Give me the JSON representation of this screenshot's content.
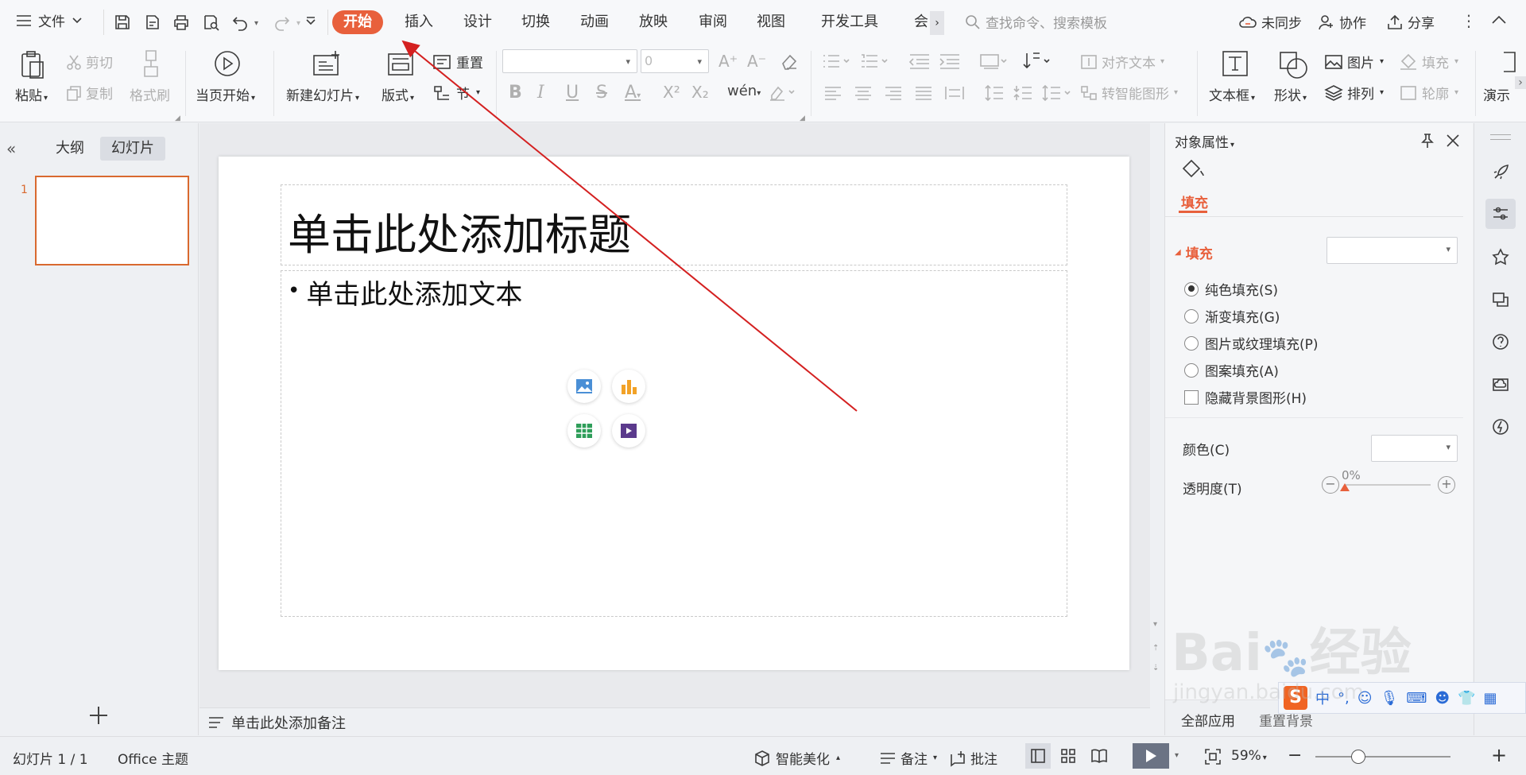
{
  "menu": {
    "file_label": "文件",
    "tabs": [
      "开始",
      "插入",
      "设计",
      "切换",
      "动画",
      "放映",
      "审阅",
      "视图",
      "开发工具",
      "会"
    ],
    "search_placeholder": "查找命令、搜索模板",
    "sync": "未同步",
    "collab": "协作",
    "share": "分享"
  },
  "ribbon": {
    "paste": "粘贴",
    "cut": "剪切",
    "copy": "复制",
    "format_painter": "格式刷",
    "start_from_current": "当页开始",
    "new_slide": "新建幻灯片",
    "layout": "版式",
    "reset": "重置",
    "section": "节",
    "font_size": "0",
    "align_text": "对齐文本",
    "convert_smartart": "转智能图形",
    "textbox": "文本框",
    "shape": "形状",
    "picture": "图片",
    "arrange": "排列",
    "fill": "填充",
    "outline": "轮廓",
    "presenter": "演示"
  },
  "left_panel": {
    "tab_outline": "大纲",
    "tab_slides": "幻灯片",
    "slide_number": "1"
  },
  "slide": {
    "title_placeholder": "单击此处添加标题",
    "body_placeholder": "单击此处添加文本"
  },
  "notes": {
    "placeholder": "单击此处添加备注"
  },
  "properties": {
    "title": "对象属性",
    "tab_fill": "填充",
    "section_fill": "填充",
    "options": [
      {
        "label": "纯色填充(S)",
        "selected": true
      },
      {
        "label": "渐变填充(G)",
        "selected": false
      },
      {
        "label": "图片或纹理填充(P)",
        "selected": false
      },
      {
        "label": "图案填充(A)",
        "selected": false
      }
    ],
    "hide_bg": "隐藏背景图形(H)",
    "color_label": "颜色(C)",
    "transparency_label": "透明度(T)",
    "transparency_value": "0%",
    "transparency_level": 0,
    "apply_all": "全部应用",
    "reset_bg": "重置背景"
  },
  "status": {
    "slide_info": "幻灯片 1 / 1",
    "theme": "Office 主题",
    "beautify": "智能美化",
    "notes": "备注",
    "comments": "批注",
    "zoom": "59%"
  },
  "watermark": {
    "text_baidu": "Bai",
    "text_jingyan": "经验",
    "url": "jingyan.baidu.com"
  },
  "colors": {
    "accent": "#e8603c",
    "annotation_arrow": "#d42020",
    "thumb_border": "#d9692f"
  }
}
